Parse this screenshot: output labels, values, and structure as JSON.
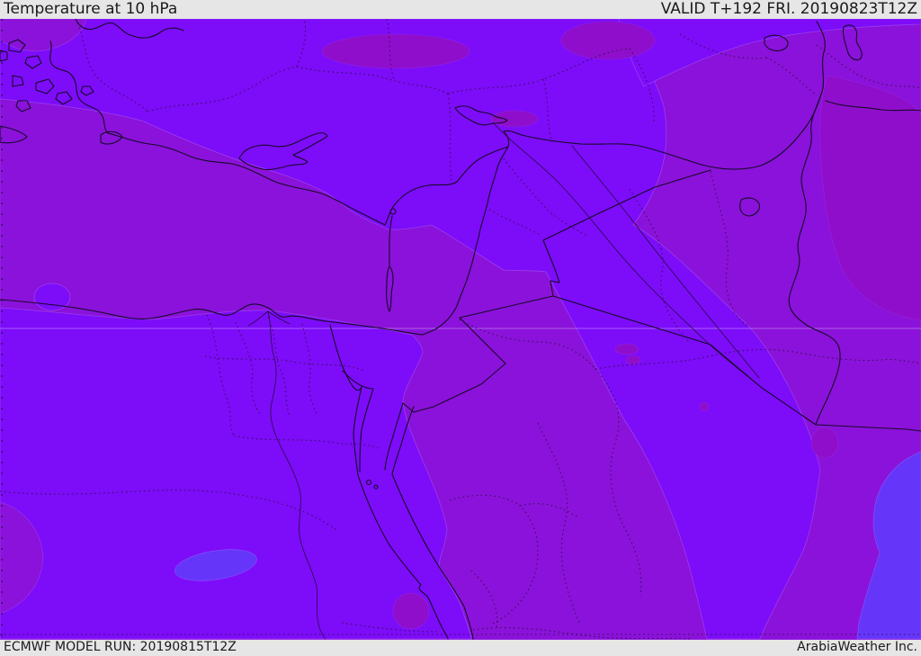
{
  "header": {
    "title": "Temperature at 10 hPa",
    "valid_time": "VALID T+192 FRI. 20190823T12Z"
  },
  "footer": {
    "model_run": "ECMWF MODEL RUN: 20190815T12Z",
    "brand": "ArabiaWeather Inc."
  },
  "map": {
    "kind": "filled-contour upper-air temperature forecast map",
    "region": "Eastern Mediterranean / Middle East (Turkey, Cyprus, Levant, Egypt, Iraq, Saudi Arabia, Iran)",
    "colors": {
      "bright_violet_fill": "#7d0cf8",
      "medium_purple_fill": "#8b12da",
      "dark_purple_fill": "#8f0ecc",
      "blue_violet_fill": "#6536fa",
      "coastline": "#160a28",
      "dotted_border": "#30104a",
      "graticule": "#d9c2ff",
      "bar_background": "#e6e6e6",
      "bar_text": "#1a1a1a"
    }
  }
}
